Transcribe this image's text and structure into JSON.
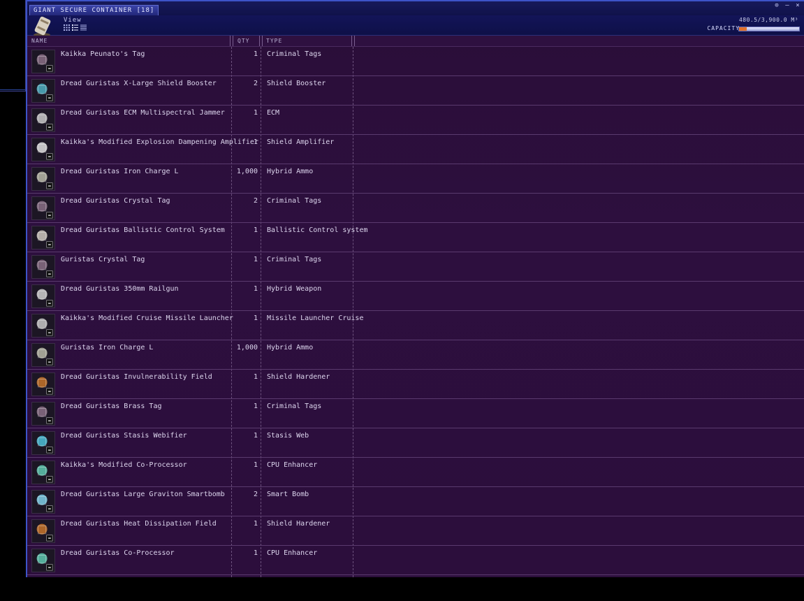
{
  "window": {
    "title": "GIANT SECURE CONTAINER [18]",
    "view_label": "View",
    "capacity_label": "CAPACITY",
    "capacity_text": "480.5/3,900.0 M³",
    "capacity_fraction": 0.123
  },
  "columns": {
    "name": "NAME",
    "qty": "QTY",
    "type": "TYPE"
  },
  "items": [
    {
      "name": "Kaikka Peunato's Tag",
      "qty": "1",
      "type": "Criminal Tags",
      "icon": "tag-icon"
    },
    {
      "name": "Dread Guristas X-Large Shield Booster",
      "qty": "2",
      "type": "Shield Booster",
      "icon": "shield-booster-icon"
    },
    {
      "name": "Dread Guristas ECM Multispectral Jammer",
      "qty": "1",
      "type": "ECM",
      "icon": "ecm-icon"
    },
    {
      "name": "Kaikka's Modified Explosion Dampening Amplifier",
      "qty": "1",
      "type": "Shield Amplifier",
      "icon": "shield-amplifier-icon"
    },
    {
      "name": "Dread Guristas Iron Charge L",
      "qty": "1,000",
      "type": "Hybrid Ammo",
      "icon": "ammo-icon"
    },
    {
      "name": "Dread Guristas Crystal Tag",
      "qty": "2",
      "type": "Criminal Tags",
      "icon": "tag-icon"
    },
    {
      "name": "Dread Guristas Ballistic Control System",
      "qty": "1",
      "type": "Ballistic Control system",
      "icon": "ballistic-control-icon"
    },
    {
      "name": "Guristas Crystal Tag",
      "qty": "1",
      "type": "Criminal Tags",
      "icon": "tag-icon"
    },
    {
      "name": "Dread Guristas 350mm Railgun",
      "qty": "1",
      "type": "Hybrid Weapon",
      "icon": "railgun-icon"
    },
    {
      "name": "Kaikka's Modified Cruise Missile Launcher",
      "qty": "1",
      "type": "Missile Launcher Cruise",
      "icon": "missile-launcher-icon"
    },
    {
      "name": "Guristas Iron Charge L",
      "qty": "1,000",
      "type": "Hybrid Ammo",
      "icon": "ammo-icon"
    },
    {
      "name": "Dread Guristas Invulnerability Field",
      "qty": "1",
      "type": "Shield Hardener",
      "icon": "shield-hardener-icon"
    },
    {
      "name": "Dread Guristas Brass Tag",
      "qty": "1",
      "type": "Criminal Tags",
      "icon": "tag-icon"
    },
    {
      "name": "Dread Guristas Stasis Webifier",
      "qty": "1",
      "type": "Stasis Web",
      "icon": "stasis-web-icon"
    },
    {
      "name": "Kaikka's Modified Co-Processor",
      "qty": "1",
      "type": "CPU Enhancer",
      "icon": "cpu-icon"
    },
    {
      "name": "Dread Guristas Large Graviton Smartbomb",
      "qty": "2",
      "type": "Smart Bomb",
      "icon": "smartbomb-icon"
    },
    {
      "name": "Dread Guristas Heat Dissipation Field",
      "qty": "1",
      "type": "Shield Hardener",
      "icon": "shield-hardener-icon"
    },
    {
      "name": "Dread Guristas Co-Processor",
      "qty": "1",
      "type": "CPU Enhancer",
      "icon": "cpu-icon"
    }
  ]
}
